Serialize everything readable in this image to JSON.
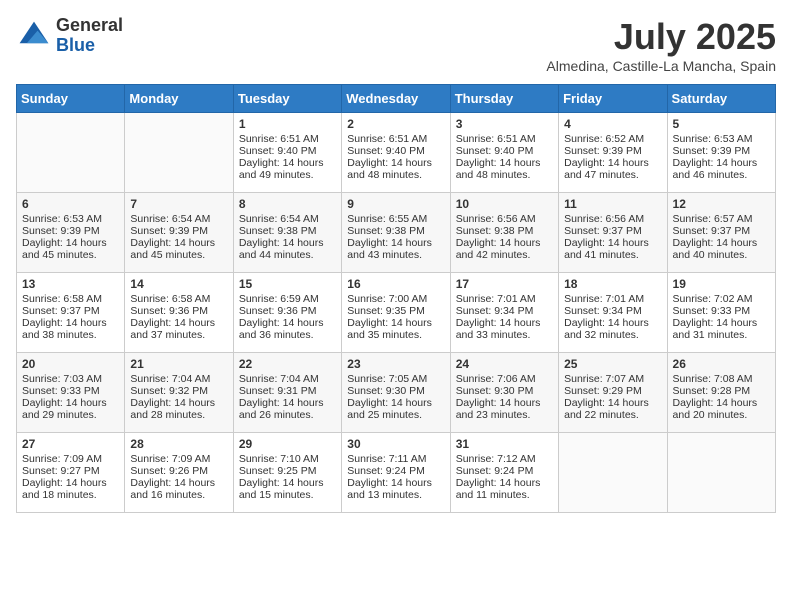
{
  "header": {
    "logo_general": "General",
    "logo_blue": "Blue",
    "month_title": "July 2025",
    "location": "Almedina, Castille-La Mancha, Spain"
  },
  "weekdays": [
    "Sunday",
    "Monday",
    "Tuesday",
    "Wednesday",
    "Thursday",
    "Friday",
    "Saturday"
  ],
  "weeks": [
    [
      {
        "day": "",
        "sunrise": "",
        "sunset": "",
        "daylight": ""
      },
      {
        "day": "",
        "sunrise": "",
        "sunset": "",
        "daylight": ""
      },
      {
        "day": "1",
        "sunrise": "Sunrise: 6:51 AM",
        "sunset": "Sunset: 9:40 PM",
        "daylight": "Daylight: 14 hours and 49 minutes."
      },
      {
        "day": "2",
        "sunrise": "Sunrise: 6:51 AM",
        "sunset": "Sunset: 9:40 PM",
        "daylight": "Daylight: 14 hours and 48 minutes."
      },
      {
        "day": "3",
        "sunrise": "Sunrise: 6:51 AM",
        "sunset": "Sunset: 9:40 PM",
        "daylight": "Daylight: 14 hours and 48 minutes."
      },
      {
        "day": "4",
        "sunrise": "Sunrise: 6:52 AM",
        "sunset": "Sunset: 9:39 PM",
        "daylight": "Daylight: 14 hours and 47 minutes."
      },
      {
        "day": "5",
        "sunrise": "Sunrise: 6:53 AM",
        "sunset": "Sunset: 9:39 PM",
        "daylight": "Daylight: 14 hours and 46 minutes."
      }
    ],
    [
      {
        "day": "6",
        "sunrise": "Sunrise: 6:53 AM",
        "sunset": "Sunset: 9:39 PM",
        "daylight": "Daylight: 14 hours and 45 minutes."
      },
      {
        "day": "7",
        "sunrise": "Sunrise: 6:54 AM",
        "sunset": "Sunset: 9:39 PM",
        "daylight": "Daylight: 14 hours and 45 minutes."
      },
      {
        "day": "8",
        "sunrise": "Sunrise: 6:54 AM",
        "sunset": "Sunset: 9:38 PM",
        "daylight": "Daylight: 14 hours and 44 minutes."
      },
      {
        "day": "9",
        "sunrise": "Sunrise: 6:55 AM",
        "sunset": "Sunset: 9:38 PM",
        "daylight": "Daylight: 14 hours and 43 minutes."
      },
      {
        "day": "10",
        "sunrise": "Sunrise: 6:56 AM",
        "sunset": "Sunset: 9:38 PM",
        "daylight": "Daylight: 14 hours and 42 minutes."
      },
      {
        "day": "11",
        "sunrise": "Sunrise: 6:56 AM",
        "sunset": "Sunset: 9:37 PM",
        "daylight": "Daylight: 14 hours and 41 minutes."
      },
      {
        "day": "12",
        "sunrise": "Sunrise: 6:57 AM",
        "sunset": "Sunset: 9:37 PM",
        "daylight": "Daylight: 14 hours and 40 minutes."
      }
    ],
    [
      {
        "day": "13",
        "sunrise": "Sunrise: 6:58 AM",
        "sunset": "Sunset: 9:37 PM",
        "daylight": "Daylight: 14 hours and 38 minutes."
      },
      {
        "day": "14",
        "sunrise": "Sunrise: 6:58 AM",
        "sunset": "Sunset: 9:36 PM",
        "daylight": "Daylight: 14 hours and 37 minutes."
      },
      {
        "day": "15",
        "sunrise": "Sunrise: 6:59 AM",
        "sunset": "Sunset: 9:36 PM",
        "daylight": "Daylight: 14 hours and 36 minutes."
      },
      {
        "day": "16",
        "sunrise": "Sunrise: 7:00 AM",
        "sunset": "Sunset: 9:35 PM",
        "daylight": "Daylight: 14 hours and 35 minutes."
      },
      {
        "day": "17",
        "sunrise": "Sunrise: 7:01 AM",
        "sunset": "Sunset: 9:34 PM",
        "daylight": "Daylight: 14 hours and 33 minutes."
      },
      {
        "day": "18",
        "sunrise": "Sunrise: 7:01 AM",
        "sunset": "Sunset: 9:34 PM",
        "daylight": "Daylight: 14 hours and 32 minutes."
      },
      {
        "day": "19",
        "sunrise": "Sunrise: 7:02 AM",
        "sunset": "Sunset: 9:33 PM",
        "daylight": "Daylight: 14 hours and 31 minutes."
      }
    ],
    [
      {
        "day": "20",
        "sunrise": "Sunrise: 7:03 AM",
        "sunset": "Sunset: 9:33 PM",
        "daylight": "Daylight: 14 hours and 29 minutes."
      },
      {
        "day": "21",
        "sunrise": "Sunrise: 7:04 AM",
        "sunset": "Sunset: 9:32 PM",
        "daylight": "Daylight: 14 hours and 28 minutes."
      },
      {
        "day": "22",
        "sunrise": "Sunrise: 7:04 AM",
        "sunset": "Sunset: 9:31 PM",
        "daylight": "Daylight: 14 hours and 26 minutes."
      },
      {
        "day": "23",
        "sunrise": "Sunrise: 7:05 AM",
        "sunset": "Sunset: 9:30 PM",
        "daylight": "Daylight: 14 hours and 25 minutes."
      },
      {
        "day": "24",
        "sunrise": "Sunrise: 7:06 AM",
        "sunset": "Sunset: 9:30 PM",
        "daylight": "Daylight: 14 hours and 23 minutes."
      },
      {
        "day": "25",
        "sunrise": "Sunrise: 7:07 AM",
        "sunset": "Sunset: 9:29 PM",
        "daylight": "Daylight: 14 hours and 22 minutes."
      },
      {
        "day": "26",
        "sunrise": "Sunrise: 7:08 AM",
        "sunset": "Sunset: 9:28 PM",
        "daylight": "Daylight: 14 hours and 20 minutes."
      }
    ],
    [
      {
        "day": "27",
        "sunrise": "Sunrise: 7:09 AM",
        "sunset": "Sunset: 9:27 PM",
        "daylight": "Daylight: 14 hours and 18 minutes."
      },
      {
        "day": "28",
        "sunrise": "Sunrise: 7:09 AM",
        "sunset": "Sunset: 9:26 PM",
        "daylight": "Daylight: 14 hours and 16 minutes."
      },
      {
        "day": "29",
        "sunrise": "Sunrise: 7:10 AM",
        "sunset": "Sunset: 9:25 PM",
        "daylight": "Daylight: 14 hours and 15 minutes."
      },
      {
        "day": "30",
        "sunrise": "Sunrise: 7:11 AM",
        "sunset": "Sunset: 9:24 PM",
        "daylight": "Daylight: 14 hours and 13 minutes."
      },
      {
        "day": "31",
        "sunrise": "Sunrise: 7:12 AM",
        "sunset": "Sunset: 9:24 PM",
        "daylight": "Daylight: 14 hours and 11 minutes."
      },
      {
        "day": "",
        "sunrise": "",
        "sunset": "",
        "daylight": ""
      },
      {
        "day": "",
        "sunrise": "",
        "sunset": "",
        "daylight": ""
      }
    ]
  ]
}
